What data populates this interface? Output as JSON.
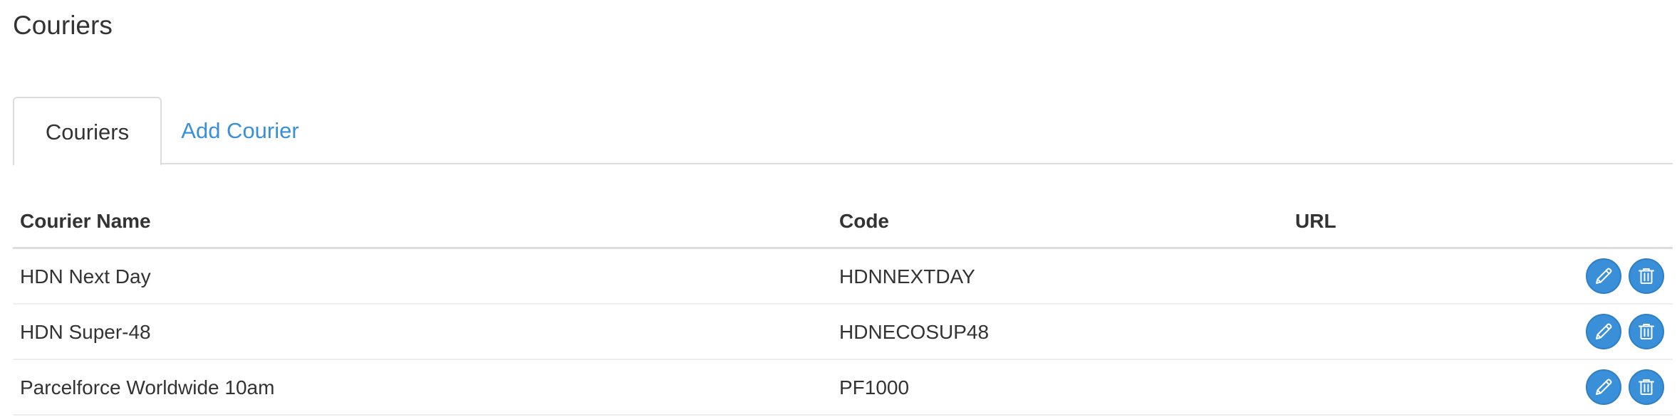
{
  "page": {
    "title": "Couriers"
  },
  "tabs": [
    {
      "label": "Couriers",
      "active": true
    },
    {
      "label": "Add Courier",
      "active": false
    }
  ],
  "table": {
    "headers": {
      "name": "Courier Name",
      "code": "Code",
      "url": "URL"
    },
    "rows": [
      {
        "name": "HDN Next Day",
        "code": "HDNNEXTDAY",
        "url": ""
      },
      {
        "name": "HDN Super-48",
        "code": "HDNECOSUP48",
        "url": ""
      },
      {
        "name": "Parcelforce Worldwide 10am",
        "code": "PF1000",
        "url": ""
      }
    ]
  },
  "icons": {
    "edit": "pencil-icon",
    "delete": "trash-icon"
  },
  "colors": {
    "accent": "#3a8fd9",
    "border": "#dddddd",
    "text": "#333333"
  }
}
